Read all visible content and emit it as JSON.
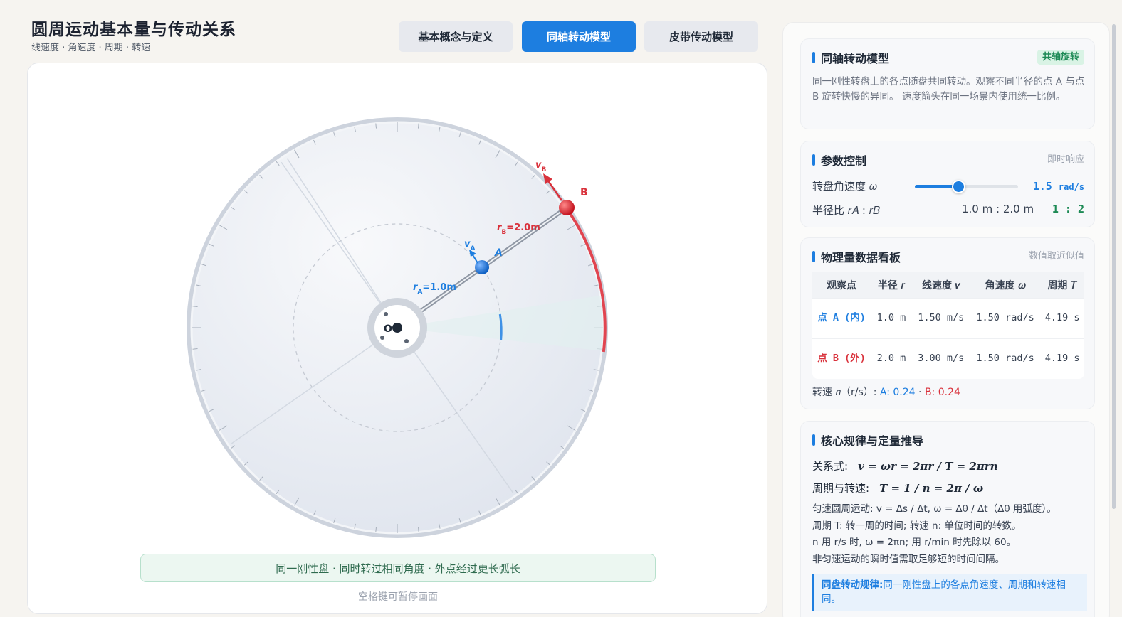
{
  "header": {
    "title": "圆周运动基本量与传动关系",
    "subtitle": "线速度 · 角速度 · 周期 · 转速"
  },
  "tabs": [
    {
      "label": "基本概念与定义",
      "active": false
    },
    {
      "label": "同轴转动模型",
      "active": true
    },
    {
      "label": "皮带传动模型",
      "active": false
    }
  ],
  "canvas": {
    "center_label": "O",
    "point_a": "A",
    "point_b": "B",
    "ra_label": "=1.0m",
    "rb_label": "=2.0m",
    "r_letter": "r",
    "v_letter": "v",
    "sub_a": "A",
    "sub_b": "B",
    "caption": "同一刚性盘 · 同时转过相同角度 · 外点经过更长弧长",
    "hint": "空格键可暂停画面"
  },
  "model_panel": {
    "title": "同轴转动模型",
    "badge": "共轴旋转",
    "description": "同一刚性转盘上的各点随盘共同转动。观察不同半径的点 A 与点 B 旋转快慢的异同。 速度箭头在同一场景内使用统一比例。"
  },
  "params_panel": {
    "title": "参数控制",
    "tag": "即时响应",
    "omega_label": "转盘角速度 𝜔",
    "omega_value": "1.5",
    "omega_unit": "rad/s",
    "omega_fraction": 0.42,
    "ratio_label": "半径比 𝑟𝐴 : 𝑟𝐵",
    "ratio_meters": "1.0 m : 2.0 m",
    "ratio_simple": "1 : 2"
  },
  "data_panel": {
    "title": "物理量数据看板",
    "tag": "数值取近似值",
    "columns": [
      "观察点",
      "半径 𝑟",
      "线速度 𝑣",
      "角速度 𝜔",
      "周期 𝑇"
    ],
    "rows": [
      {
        "point": "点 A (内)",
        "r": "1.0 m",
        "v": "1.50 m/s",
        "w": "1.50 rad/s",
        "T": "4.19 s"
      },
      {
        "point": "点 B (外)",
        "r": "2.0 m",
        "v": "3.00 m/s",
        "w": "1.50 rad/s",
        "T": "4.19 s"
      }
    ],
    "speed_prefix": "转速 𝑛（r/s）:",
    "speed_a": "A: 0.24",
    "speed_sep": "·",
    "speed_b": "B: 0.24"
  },
  "law_panel": {
    "title": "核心规律与定量推导",
    "relation_label": "关系式:",
    "relation_formula": "v = ωr = 2πr / T = 2πrn",
    "period_label": "周期与转速:",
    "period_formula": "T = 1 / n = 2π / ω",
    "note1": "匀速圆周运动: v = Δs / Δt, ω = Δθ / Δt（Δθ 用弧度）。",
    "note2": "周期 T: 转一周的时间; 转速 n: 单位时间的转数。",
    "note3": "n 用 r/s 时, ω = 2πn; 用 r/min 时先除以 60。",
    "note4": "非匀速运动的瞬时值需取足够短的时间间隔。",
    "law_title": "同盘转动规律:",
    "law_text": "同一刚性盘上的各点角速度、周期和转速相同。"
  }
}
